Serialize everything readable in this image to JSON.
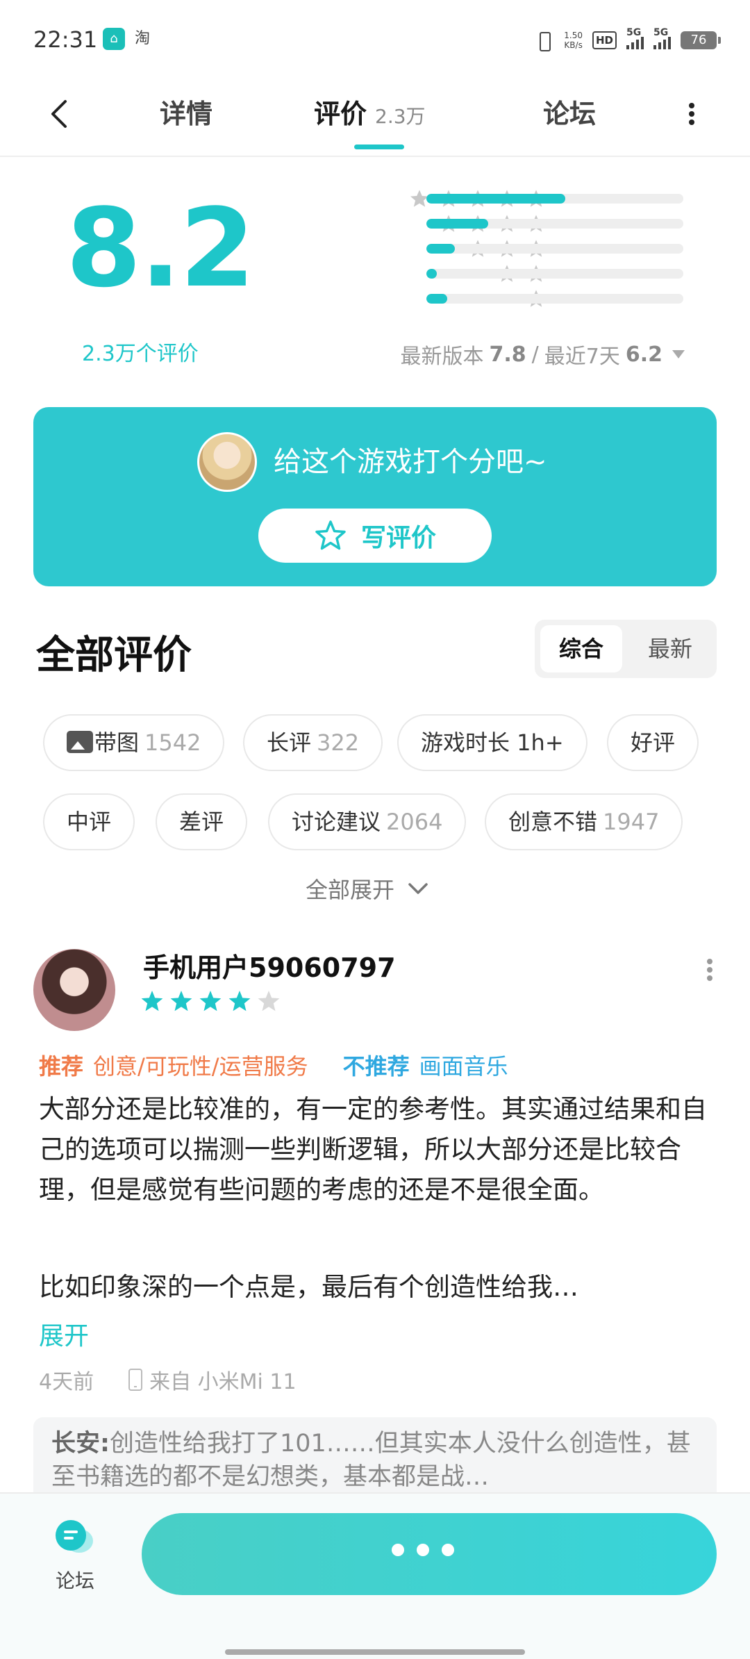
{
  "status_bar": {
    "time": "22:31",
    "app_icons": [
      "home-icon",
      "taobao-icon"
    ],
    "taobao_label": "淘",
    "net_speed_value": "1.50",
    "net_speed_unit": "KB/s",
    "hd_label": "HD",
    "network_1": "5G",
    "network_2": "5G",
    "battery": "76"
  },
  "nav": {
    "tabs": [
      {
        "label": "详情"
      },
      {
        "label": "评价",
        "count": "2.3万"
      },
      {
        "label": "论坛"
      }
    ],
    "active_tab": "评价"
  },
  "rating": {
    "score": "8.2",
    "count_label": "2.3万个评价",
    "distribution": [
      {
        "stars": 5,
        "fraction": 0.54
      },
      {
        "stars": 4,
        "fraction": 0.24
      },
      {
        "stars": 3,
        "fraction": 0.11
      },
      {
        "stars": 2,
        "fraction": 0.04
      },
      {
        "stars": 1,
        "fraction": 0.08
      }
    ],
    "version_label": "最新版本",
    "version_score": "7.8",
    "separator": "/",
    "recent_label": "最近7天",
    "recent_score": "6.2"
  },
  "rate_card": {
    "prompt": "给这个游戏打个分吧~",
    "button_label": "写评价"
  },
  "reviews_section": {
    "title": "全部评价",
    "sort_options": [
      "综合",
      "最新"
    ],
    "selected_sort": "综合",
    "filters": [
      {
        "label": "带图",
        "count": "1542",
        "icon": "image-icon"
      },
      {
        "label": "长评",
        "count": "322"
      },
      {
        "label": "游戏时长 1h+"
      },
      {
        "label": "好评"
      },
      {
        "label": "中评"
      },
      {
        "label": "差评"
      },
      {
        "label": "讨论建议",
        "count": "2064"
      },
      {
        "label": "创意不错",
        "count": "1947"
      }
    ],
    "expand_all": "全部展开"
  },
  "review": {
    "username": "手机用户59060797",
    "stars": 4,
    "max_stars": 5,
    "recommend_label": "推荐",
    "recommend_items": "创意/可玩性/运营服务",
    "not_recommend_label": "不推荐",
    "not_recommend_items": "画面音乐",
    "body": "大部分还是比较准的，有一定的参考性。其实通过结果和自己的选项可以揣测一些判断逻辑，所以大部分还是比较合理，但是感觉有些问题的考虑的还是不是很全面。",
    "body_2": "比如印象深的一个点是，最后有个创造性给我…",
    "expand_label": "展开",
    "time": "4天前",
    "device": "来自 小米Mi 11",
    "reply_name": "长安:",
    "reply_text": "创造性给我打了101……但其实本人没什么创造性，甚至书籍选的都不是幻想类，基本都是战…"
  },
  "bottom_bar": {
    "forum_label": "论坛"
  },
  "colors": {
    "accent": "#1ec6c9",
    "card": "#2ec8cf",
    "recommend": "#f07a48",
    "not_recommend": "#2fa8e0"
  }
}
